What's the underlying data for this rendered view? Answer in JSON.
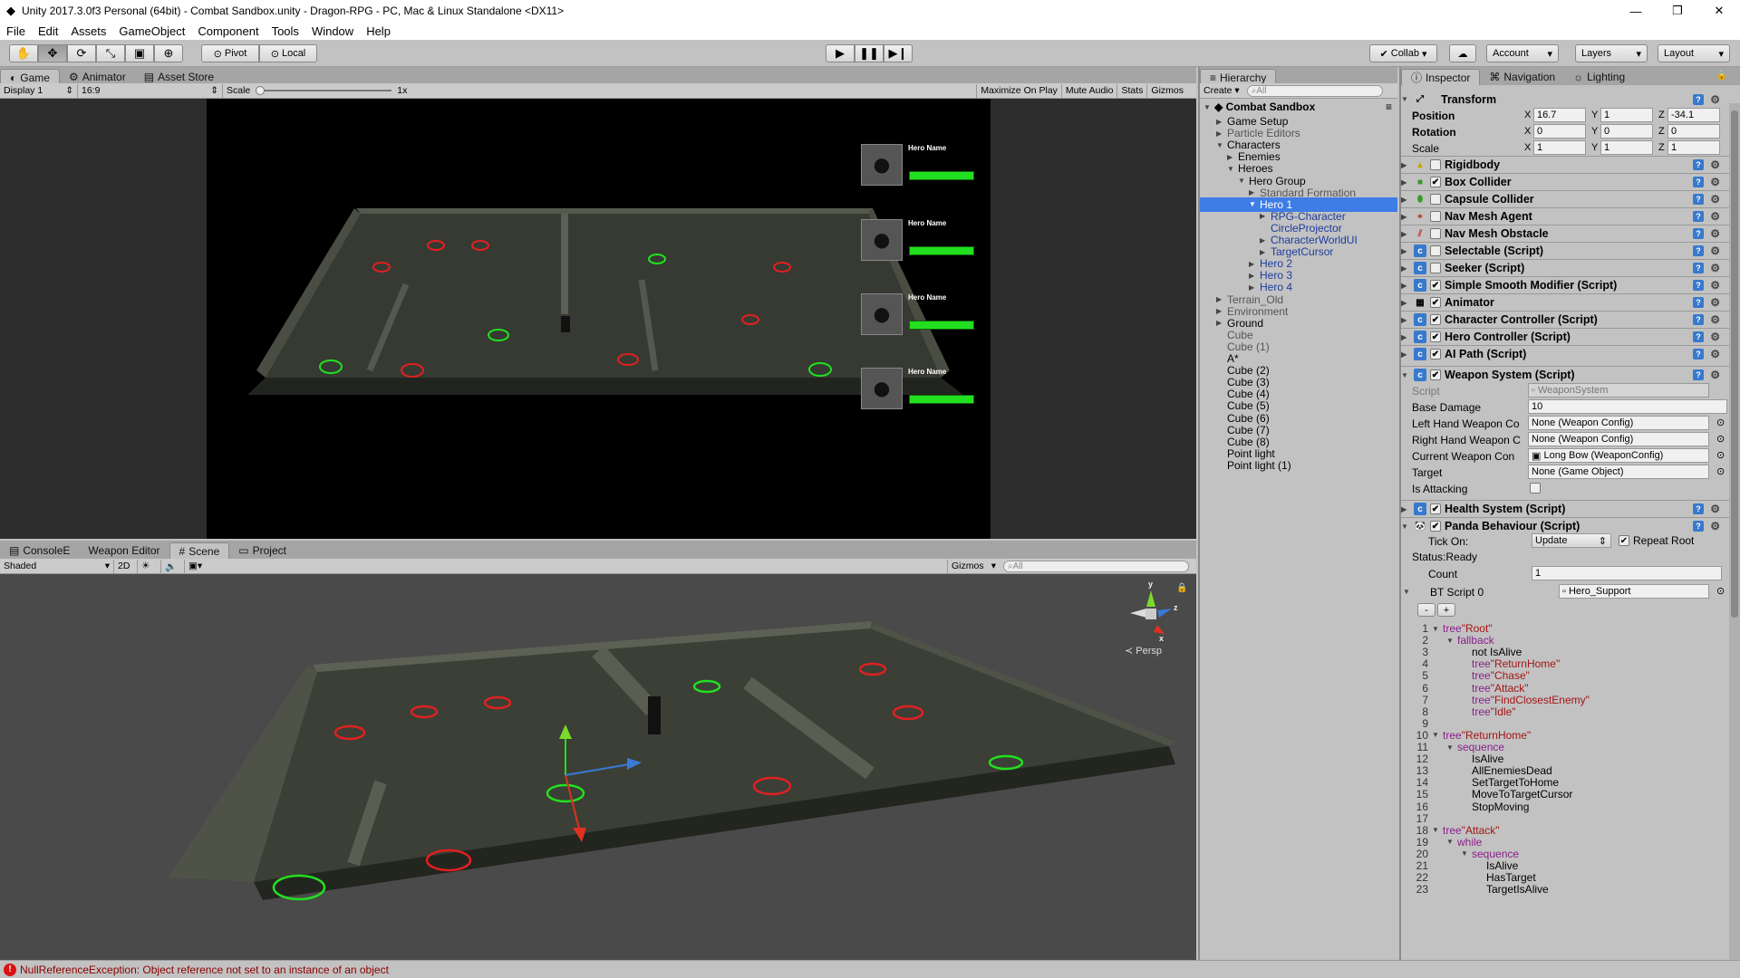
{
  "window": {
    "title": "Unity 2017.3.0f3 Personal (64bit) - Combat Sandbox.unity - Dragon-RPG - PC, Mac & Linux Standalone <DX11>",
    "minimize": "—",
    "maximize": "❐",
    "close": "✕"
  },
  "menu": [
    "File",
    "Edit",
    "Assets",
    "GameObject",
    "Component",
    "Tools",
    "Window",
    "Help"
  ],
  "toolbar": {
    "pivot": "Pivot",
    "local": "Local",
    "collab": "Collab",
    "account": "Account",
    "layers": "Layers",
    "layout": "Layout"
  },
  "game_tabs": {
    "game": "Game",
    "animator": "Animator",
    "asset_store": "Asset Store"
  },
  "game_bar": {
    "display": "Display 1",
    "aspect": "16:9",
    "scale_label": "Scale",
    "scale_value": "1x",
    "maximize": "Maximize On Play",
    "mute": "Mute Audio",
    "stats": "Stats",
    "gizmos": "Gizmos"
  },
  "heroes_ui": [
    {
      "name": "Hero Name",
      "health": 1.0
    },
    {
      "name": "Hero Name",
      "health": 1.0
    },
    {
      "name": "Hero Name",
      "health": 1.0
    },
    {
      "name": "Hero Name",
      "health": 1.0
    }
  ],
  "scene_tabs": {
    "console": "ConsoleE",
    "weapon_editor": "Weapon Editor",
    "scene": "Scene",
    "project": "Project"
  },
  "scene_bar": {
    "shading": "Shaded",
    "mode2d": "2D",
    "gizmos": "Gizmos",
    "search_placeholder": "All"
  },
  "scene_gizmo": {
    "persp": "Persp",
    "y": "y",
    "z": "z",
    "x": "x"
  },
  "hierarchy": {
    "tab": "Hierarchy",
    "create": "Create",
    "search_placeholder": "All",
    "scene_name": "Combat Sandbox",
    "items": [
      {
        "label": "Game Setup",
        "style": ""
      },
      {
        "label": "Particle Editors",
        "style": "grey"
      },
      {
        "label": "Characters",
        "style": ""
      },
      {
        "label": "Enemies",
        "style": ""
      },
      {
        "label": "Heroes",
        "style": ""
      },
      {
        "label": "Hero Group",
        "style": ""
      },
      {
        "label": "Standard Formation",
        "style": "grey"
      },
      {
        "label": "Hero 1",
        "style": "sel"
      },
      {
        "label": "RPG-Character",
        "style": "blue"
      },
      {
        "label": "CircleProjector",
        "style": "blue"
      },
      {
        "label": "CharacterWorldUI",
        "style": "blue"
      },
      {
        "label": "TargetCursor",
        "style": "blue"
      },
      {
        "label": "Hero 2",
        "style": "blue"
      },
      {
        "label": "Hero 3",
        "style": "blue"
      },
      {
        "label": "Hero 4",
        "style": "blue"
      },
      {
        "label": "Terrain_Old",
        "style": "grey"
      },
      {
        "label": "Environment",
        "style": "grey"
      },
      {
        "label": "Ground",
        "style": ""
      },
      {
        "label": "Cube",
        "style": "grey"
      },
      {
        "label": "Cube (1)",
        "style": "grey"
      },
      {
        "label": "A*",
        "style": ""
      },
      {
        "label": "Cube (2)",
        "style": ""
      },
      {
        "label": "Cube (3)",
        "style": ""
      },
      {
        "label": "Cube (4)",
        "style": ""
      },
      {
        "label": "Cube (5)",
        "style": ""
      },
      {
        "label": "Cube (6)",
        "style": ""
      },
      {
        "label": "Cube (7)",
        "style": ""
      },
      {
        "label": "Cube (8)",
        "style": ""
      },
      {
        "label": "Point light",
        "style": ""
      },
      {
        "label": "Point light (1)",
        "style": ""
      }
    ]
  },
  "inspector": {
    "tabs": {
      "inspector": "Inspector",
      "navigation": "Navigation",
      "lighting": "Lighting"
    },
    "transform": {
      "title": "Transform",
      "position_label": "Position",
      "position": {
        "x": "16.7",
        "y": "1",
        "z": "-34.1"
      },
      "rotation_label": "Rotation",
      "rotation": {
        "x": "0",
        "y": "0",
        "z": "0"
      },
      "scale_label": "Scale",
      "scale": {
        "x": "1",
        "y": "1",
        "z": "1"
      },
      "axis_x": "X",
      "axis_y": "Y",
      "axis_z": "Z"
    },
    "components": [
      {
        "name": "Rigidbody",
        "checkbox": false,
        "icon": "rigidbody-icon"
      },
      {
        "name": "Box Collider",
        "checkbox": true,
        "icon": "box-collider-icon"
      },
      {
        "name": "Capsule Collider",
        "checkbox": false,
        "icon": "capsule-collider-icon"
      },
      {
        "name": "Nav Mesh Agent",
        "checkbox": false,
        "icon": "nav-agent-icon"
      },
      {
        "name": "Nav Mesh Obstacle",
        "checkbox": false,
        "icon": "nav-obstacle-icon"
      },
      {
        "name": "Selectable (Script)",
        "checkbox": false,
        "icon": "script-icon"
      },
      {
        "name": "Seeker (Script)",
        "checkbox": false,
        "icon": "script-icon"
      },
      {
        "name": "Simple Smooth Modifier (Script)",
        "checkbox": true,
        "icon": "script-icon"
      },
      {
        "name": "Animator",
        "checkbox": true,
        "icon": "animator-icon"
      },
      {
        "name": "Character Controller (Script)",
        "checkbox": true,
        "icon": "script-icon"
      },
      {
        "name": "Hero Controller (Script)",
        "checkbox": true,
        "icon": "script-icon"
      },
      {
        "name": "AI Path (Script)",
        "checkbox": true,
        "icon": "script-icon"
      }
    ],
    "weapon_system": {
      "title": "Weapon System (Script)",
      "script_label": "Script",
      "script_value": "WeaponSystem",
      "base_damage_label": "Base Damage",
      "base_damage": "10",
      "left_hand_label": "Left Hand Weapon Co",
      "left_hand": "None (Weapon Config)",
      "right_hand_label": "Right Hand Weapon C",
      "right_hand": "None (Weapon Config)",
      "current_label": "Current Weapon Con",
      "current": "Long Bow (WeaponConfig)",
      "target_label": "Target",
      "target": "None (Game Object)",
      "attacking_label": "Is Attacking"
    },
    "health_system": "Health System (Script)",
    "panda": {
      "title": "Panda Behaviour (Script)",
      "tick_label": "Tick On:",
      "tick_value": "Update",
      "repeat_root": "Repeat Root",
      "status": "Status:Ready",
      "count_label": "Count",
      "count": "1",
      "bt_label": "BT Script 0",
      "bt_value": "Hero_Support",
      "minus": "-",
      "plus": "+"
    },
    "code": [
      {
        "n": "1",
        "indent": 0,
        "tri": true,
        "kw": "tree",
        "str": "\"Root\"",
        "txt": ""
      },
      {
        "n": "2",
        "indent": 1,
        "tri": true,
        "kw": "fallback",
        "str": "",
        "txt": ""
      },
      {
        "n": "3",
        "indent": 2,
        "tri": false,
        "kw": "",
        "str": "",
        "txt": "not IsAlive"
      },
      {
        "n": "4",
        "indent": 2,
        "tri": false,
        "kw": "tree",
        "str": "\"ReturnHome\"",
        "txt": ""
      },
      {
        "n": "5",
        "indent": 2,
        "tri": false,
        "kw": "tree",
        "str": "\"Chase\"",
        "txt": ""
      },
      {
        "n": "6",
        "indent": 2,
        "tri": false,
        "kw": "tree",
        "str": "\"Attack\"",
        "txt": ""
      },
      {
        "n": "7",
        "indent": 2,
        "tri": false,
        "kw": "tree",
        "str": "\"FindClosestEnemy\"",
        "txt": ""
      },
      {
        "n": "8",
        "indent": 2,
        "tri": false,
        "kw": "tree",
        "str": "\"Idle\"",
        "txt": ""
      },
      {
        "n": "9",
        "indent": 0,
        "tri": false,
        "kw": "",
        "str": "",
        "txt": ""
      },
      {
        "n": "10",
        "indent": 0,
        "tri": true,
        "kw": "tree",
        "str": "\"ReturnHome\"",
        "txt": ""
      },
      {
        "n": "11",
        "indent": 1,
        "tri": true,
        "kw": "sequence",
        "str": "",
        "txt": ""
      },
      {
        "n": "12",
        "indent": 2,
        "tri": false,
        "kw": "",
        "str": "",
        "txt": "IsAlive"
      },
      {
        "n": "13",
        "indent": 2,
        "tri": false,
        "kw": "",
        "str": "",
        "txt": "AllEnemiesDead"
      },
      {
        "n": "14",
        "indent": 2,
        "tri": false,
        "kw": "",
        "str": "",
        "txt": "SetTargetToHome"
      },
      {
        "n": "15",
        "indent": 2,
        "tri": false,
        "kw": "",
        "str": "",
        "txt": "MoveToTargetCursor"
      },
      {
        "n": "16",
        "indent": 2,
        "tri": false,
        "kw": "",
        "str": "",
        "txt": "StopMoving"
      },
      {
        "n": "17",
        "indent": 0,
        "tri": false,
        "kw": "",
        "str": "",
        "txt": ""
      },
      {
        "n": "18",
        "indent": 0,
        "tri": true,
        "kw": "tree",
        "str": "\"Attack\"",
        "txt": ""
      },
      {
        "n": "19",
        "indent": 1,
        "tri": true,
        "kw": "while",
        "str": "",
        "txt": ""
      },
      {
        "n": "20",
        "indent": 2,
        "tri": true,
        "kw": "sequence",
        "str": "",
        "txt": ""
      },
      {
        "n": "21",
        "indent": 3,
        "tri": false,
        "kw": "",
        "str": "",
        "txt": "IsAlive"
      },
      {
        "n": "22",
        "indent": 3,
        "tri": false,
        "kw": "",
        "str": "",
        "txt": "HasTarget"
      },
      {
        "n": "23",
        "indent": 3,
        "tri": false,
        "kw": "",
        "str": "",
        "txt": "TargetIsAlive"
      }
    ]
  },
  "status": {
    "message": "NullReferenceException: Object reference not set to an instance of an object"
  },
  "colors": {
    "selection": "#3e7de6",
    "accent_blue": "#1c3c9c",
    "error": "#d11111",
    "health_green": "#22e01f"
  }
}
